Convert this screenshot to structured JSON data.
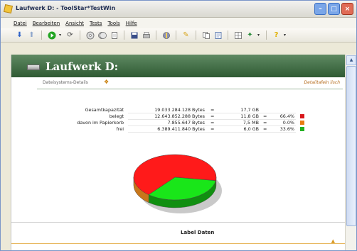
{
  "window": {
    "title": "Laufwerk D: - ToolStar*TestWin"
  },
  "menu": [
    "Datei",
    "Bearbeiten",
    "Ansicht",
    "Tests",
    "Tools",
    "Hilfe"
  ],
  "toolbar": {
    "icons": [
      "down-arrow-icon",
      "up-arrow-icon",
      "separator",
      "go-icon",
      "dropdown",
      "refresh-icon",
      "separator",
      "disc-icon",
      "disc-group-icon",
      "file-icon",
      "separator",
      "save-icon",
      "print-icon",
      "separator",
      "tool-icon",
      "separator",
      "tag-icon",
      "separator",
      "copy-icon",
      "page-icon",
      "separator",
      "grid-icon",
      "wizard-icon",
      "dropdown",
      "separator",
      "help-icon",
      "dropdown"
    ]
  },
  "page": {
    "title": "Laufwerk D:",
    "details_link": "Dateisystems-Details",
    "details_hint": "Detailtafeln lisch"
  },
  "stats": [
    {
      "label": "Gesamtkapazität",
      "bytes": "19.033.284.128 Bytes",
      "eq1": "=",
      "gb": "17,7 GB",
      "eq2": "",
      "pct": "",
      "color": ""
    },
    {
      "label": "belegt",
      "bytes": "12.643.852.288 Bytes",
      "eq1": "=",
      "gb": "11,8 GB",
      "eq2": "=",
      "pct": "66.4%",
      "color": "#d8171b"
    },
    {
      "label": "davon im Papierkorb",
      "bytes": "7.855.647 Bytes",
      "eq1": "=",
      "gb": "7,5 MB",
      "eq2": "=",
      "pct": "0.0%",
      "color": "#e87b12"
    },
    {
      "label": "frei",
      "bytes": "6.389.411.840 Bytes",
      "eq1": "=",
      "gb": "6,0 GB",
      "eq2": "=",
      "pct": "33.6%",
      "color": "#22b022"
    }
  ],
  "chart_data": {
    "type": "pie",
    "slices": [
      {
        "label": "belegt",
        "value": 66.4,
        "color": "#ff1a1a"
      },
      {
        "label": "frei",
        "value": 33.6,
        "color": "#19e619"
      }
    ]
  },
  "bottom": {
    "label": "Label Daten"
  }
}
